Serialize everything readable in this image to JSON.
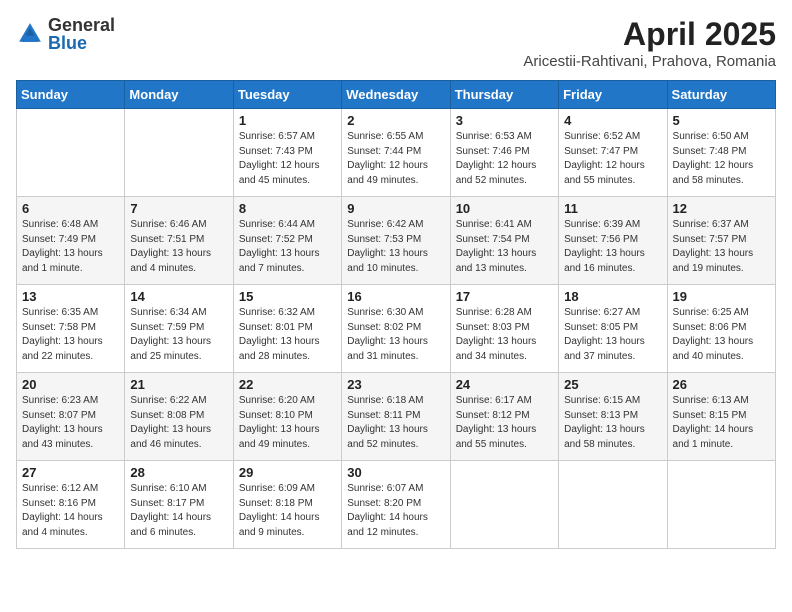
{
  "header": {
    "logo_general": "General",
    "logo_blue": "Blue",
    "title": "April 2025",
    "subtitle": "Aricestii-Rahtivani, Prahova, Romania"
  },
  "weekdays": [
    "Sunday",
    "Monday",
    "Tuesday",
    "Wednesday",
    "Thursday",
    "Friday",
    "Saturday"
  ],
  "weeks": [
    [
      {
        "day": "",
        "detail": ""
      },
      {
        "day": "",
        "detail": ""
      },
      {
        "day": "1",
        "detail": "Sunrise: 6:57 AM\nSunset: 7:43 PM\nDaylight: 12 hours\nand 45 minutes."
      },
      {
        "day": "2",
        "detail": "Sunrise: 6:55 AM\nSunset: 7:44 PM\nDaylight: 12 hours\nand 49 minutes."
      },
      {
        "day": "3",
        "detail": "Sunrise: 6:53 AM\nSunset: 7:46 PM\nDaylight: 12 hours\nand 52 minutes."
      },
      {
        "day": "4",
        "detail": "Sunrise: 6:52 AM\nSunset: 7:47 PM\nDaylight: 12 hours\nand 55 minutes."
      },
      {
        "day": "5",
        "detail": "Sunrise: 6:50 AM\nSunset: 7:48 PM\nDaylight: 12 hours\nand 58 minutes."
      }
    ],
    [
      {
        "day": "6",
        "detail": "Sunrise: 6:48 AM\nSunset: 7:49 PM\nDaylight: 13 hours\nand 1 minute."
      },
      {
        "day": "7",
        "detail": "Sunrise: 6:46 AM\nSunset: 7:51 PM\nDaylight: 13 hours\nand 4 minutes."
      },
      {
        "day": "8",
        "detail": "Sunrise: 6:44 AM\nSunset: 7:52 PM\nDaylight: 13 hours\nand 7 minutes."
      },
      {
        "day": "9",
        "detail": "Sunrise: 6:42 AM\nSunset: 7:53 PM\nDaylight: 13 hours\nand 10 minutes."
      },
      {
        "day": "10",
        "detail": "Sunrise: 6:41 AM\nSunset: 7:54 PM\nDaylight: 13 hours\nand 13 minutes."
      },
      {
        "day": "11",
        "detail": "Sunrise: 6:39 AM\nSunset: 7:56 PM\nDaylight: 13 hours\nand 16 minutes."
      },
      {
        "day": "12",
        "detail": "Sunrise: 6:37 AM\nSunset: 7:57 PM\nDaylight: 13 hours\nand 19 minutes."
      }
    ],
    [
      {
        "day": "13",
        "detail": "Sunrise: 6:35 AM\nSunset: 7:58 PM\nDaylight: 13 hours\nand 22 minutes."
      },
      {
        "day": "14",
        "detail": "Sunrise: 6:34 AM\nSunset: 7:59 PM\nDaylight: 13 hours\nand 25 minutes."
      },
      {
        "day": "15",
        "detail": "Sunrise: 6:32 AM\nSunset: 8:01 PM\nDaylight: 13 hours\nand 28 minutes."
      },
      {
        "day": "16",
        "detail": "Sunrise: 6:30 AM\nSunset: 8:02 PM\nDaylight: 13 hours\nand 31 minutes."
      },
      {
        "day": "17",
        "detail": "Sunrise: 6:28 AM\nSunset: 8:03 PM\nDaylight: 13 hours\nand 34 minutes."
      },
      {
        "day": "18",
        "detail": "Sunrise: 6:27 AM\nSunset: 8:05 PM\nDaylight: 13 hours\nand 37 minutes."
      },
      {
        "day": "19",
        "detail": "Sunrise: 6:25 AM\nSunset: 8:06 PM\nDaylight: 13 hours\nand 40 minutes."
      }
    ],
    [
      {
        "day": "20",
        "detail": "Sunrise: 6:23 AM\nSunset: 8:07 PM\nDaylight: 13 hours\nand 43 minutes."
      },
      {
        "day": "21",
        "detail": "Sunrise: 6:22 AM\nSunset: 8:08 PM\nDaylight: 13 hours\nand 46 minutes."
      },
      {
        "day": "22",
        "detail": "Sunrise: 6:20 AM\nSunset: 8:10 PM\nDaylight: 13 hours\nand 49 minutes."
      },
      {
        "day": "23",
        "detail": "Sunrise: 6:18 AM\nSunset: 8:11 PM\nDaylight: 13 hours\nand 52 minutes."
      },
      {
        "day": "24",
        "detail": "Sunrise: 6:17 AM\nSunset: 8:12 PM\nDaylight: 13 hours\nand 55 minutes."
      },
      {
        "day": "25",
        "detail": "Sunrise: 6:15 AM\nSunset: 8:13 PM\nDaylight: 13 hours\nand 58 minutes."
      },
      {
        "day": "26",
        "detail": "Sunrise: 6:13 AM\nSunset: 8:15 PM\nDaylight: 14 hours\nand 1 minute."
      }
    ],
    [
      {
        "day": "27",
        "detail": "Sunrise: 6:12 AM\nSunset: 8:16 PM\nDaylight: 14 hours\nand 4 minutes."
      },
      {
        "day": "28",
        "detail": "Sunrise: 6:10 AM\nSunset: 8:17 PM\nDaylight: 14 hours\nand 6 minutes."
      },
      {
        "day": "29",
        "detail": "Sunrise: 6:09 AM\nSunset: 8:18 PM\nDaylight: 14 hours\nand 9 minutes."
      },
      {
        "day": "30",
        "detail": "Sunrise: 6:07 AM\nSunset: 8:20 PM\nDaylight: 14 hours\nand 12 minutes."
      },
      {
        "day": "",
        "detail": ""
      },
      {
        "day": "",
        "detail": ""
      },
      {
        "day": "",
        "detail": ""
      }
    ]
  ]
}
